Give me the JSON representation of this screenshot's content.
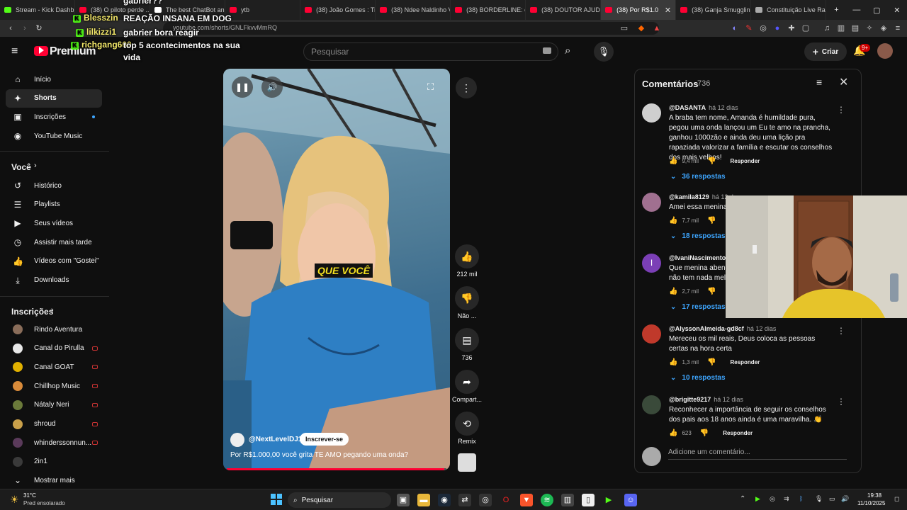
{
  "browser": {
    "tabs": [
      {
        "label": "Stream - Kick Dashb",
        "color": "#53fc18"
      },
      {
        "label": "(38) O piloto perde ...",
        "color": "#ff0033"
      },
      {
        "label": "The best ChatBot and",
        "color": "#ffffff"
      },
      {
        "label": "ytb",
        "color": "#ff0033"
      },
      {
        "label": "(38) João Gomes : Tim",
        "color": "#ff0033"
      },
      {
        "label": "(38) Ndee Naldinho V",
        "color": "#ff0033"
      },
      {
        "label": "(38) BORDERLINE: o tr",
        "color": "#ff0033"
      },
      {
        "label": "(38) DOUTOR AJUDA",
        "color": "#ff0033"
      },
      {
        "label": "(38) Por R$1.0",
        "color": "#ff0033"
      },
      {
        "label": "(38) Ganja Smuggling",
        "color": "#ff0033"
      },
      {
        "label": "Constituição Live Rast",
        "color": "#aaaaaa"
      }
    ],
    "url": "youtube.com/shorts/GNLFkvvMmRQ"
  },
  "chat": [
    {
      "user": "",
      "message": "gabrier??"
    },
    {
      "user": "Blesszin",
      "message": "REAÇÃO INSANA EM DOG"
    },
    {
      "user": "lilkizzi1",
      "message": "gabrier bora reagir"
    },
    {
      "user": "richgang600",
      "message": "top 5 acontecimentos na sua vida"
    }
  ],
  "header": {
    "logo": "Premium",
    "search_placeholder": "Pesquisar",
    "create_label": "Criar",
    "notif_count": "9+"
  },
  "sidebar": {
    "items": [
      {
        "label": "Início",
        "icon": "home-icon",
        "glyph": "⌂"
      },
      {
        "label": "Shorts",
        "icon": "shorts-icon",
        "glyph": "✦"
      },
      {
        "label": "Inscrições",
        "icon": "subscriptions-icon",
        "glyph": "▣"
      },
      {
        "label": "YouTube Music",
        "icon": "music-icon",
        "glyph": "◉"
      }
    ],
    "you_title": "Você",
    "you_items": [
      {
        "label": "Histórico",
        "icon": "history-icon",
        "glyph": "↺"
      },
      {
        "label": "Playlists",
        "icon": "playlists-icon",
        "glyph": "☰"
      },
      {
        "label": "Seus vídeos",
        "icon": "your-videos-icon",
        "glyph": "▶"
      },
      {
        "label": "Assistir mais tarde",
        "icon": "watch-later-icon",
        "glyph": "◷"
      },
      {
        "label": "Vídeos com \"Gostei\"",
        "icon": "liked-icon",
        "glyph": "👍"
      },
      {
        "label": "Downloads",
        "icon": "downloads-icon",
        "glyph": "⤓"
      }
    ],
    "subs_title": "Inscrições",
    "subs": [
      {
        "label": "Rindo Aventura",
        "color": "#8a6d5a"
      },
      {
        "label": "Canal do Pirulla",
        "color": "#e8e8e8"
      },
      {
        "label": "Canal GOAT",
        "color": "#e0b000"
      },
      {
        "label": "Chillhop Music",
        "color": "#d98b3a"
      },
      {
        "label": "Nátaly Neri",
        "color": "#6b7a3a"
      },
      {
        "label": "shroud",
        "color": "#c9a04a"
      },
      {
        "label": "whinderssonnun...",
        "color": "#5a3a5a"
      },
      {
        "label": "2in1",
        "color": "#3a3a3a"
      }
    ],
    "show_more": "Mostrar mais"
  },
  "video": {
    "caption": "QUE VOCÊ",
    "channel": "@NextLevelDJ1",
    "subscribe_label": "Inscrever-se",
    "title": "Por R$1.000,00 você grita TE AMO pegando uma onda?",
    "progress": 0.99
  },
  "actions": {
    "likes": "212 mil",
    "dislike_label": "Não ...",
    "comments": "736",
    "share_label": "Compart...",
    "remix_label": "Remix"
  },
  "comments": {
    "title": "Comentários",
    "count": "736",
    "add_placeholder": "Adicione um comentário...",
    "reply_label": "Responder",
    "items": [
      {
        "user": "@DASANTA",
        "time": "há 12 dias",
        "text": "A braba tem nome, Amanda é humildade pura, pegou uma onda lançou um Eu te amo na prancha, ganhou 1000zão e ainda deu uma lição pra rapaziada valorizar a família e escutar os conselhos dos mais velhos!",
        "likes": "9,4 mil",
        "replies": "36 respostas",
        "color": "#cfcfcf"
      },
      {
        "user": "@kamila8129",
        "time": "há 12 d",
        "text": "Amei essa menina,",
        "likes": "7,7 mil",
        "replies": "18 respostas",
        "color": "#a07090"
      },
      {
        "user": "@IvaniNascimento-p",
        "time": "",
        "text": "Que menina abenç\nnão tem nada melh",
        "likes": "2,7 mil",
        "replies": "17 respostas",
        "color": "#7b3fb6",
        "initial": "I"
      },
      {
        "user": "@AlyssonAlmeida-gd8cf",
        "time": "há 12 dias",
        "text": "Mereceu os mil reais, Deus coloca as pessoas certas na hora certa",
        "likes": "1,3 mil",
        "replies": "10 respostas",
        "color": "#c0392b"
      },
      {
        "user": "@brigitte9217",
        "time": "há 12 dias",
        "text": "Reconhecer a importância de seguir os conselhos dos pais aos 18 anos ainda é uma maravilha. 👏",
        "likes": "623",
        "replies": "",
        "color": "#3a4a3a"
      }
    ]
  },
  "taskbar": {
    "weather_temp": "31°C",
    "weather_desc": "Pred ensolarado",
    "search_label": "Pesquisar",
    "time": "19:38",
    "date": "11/10/2025"
  }
}
